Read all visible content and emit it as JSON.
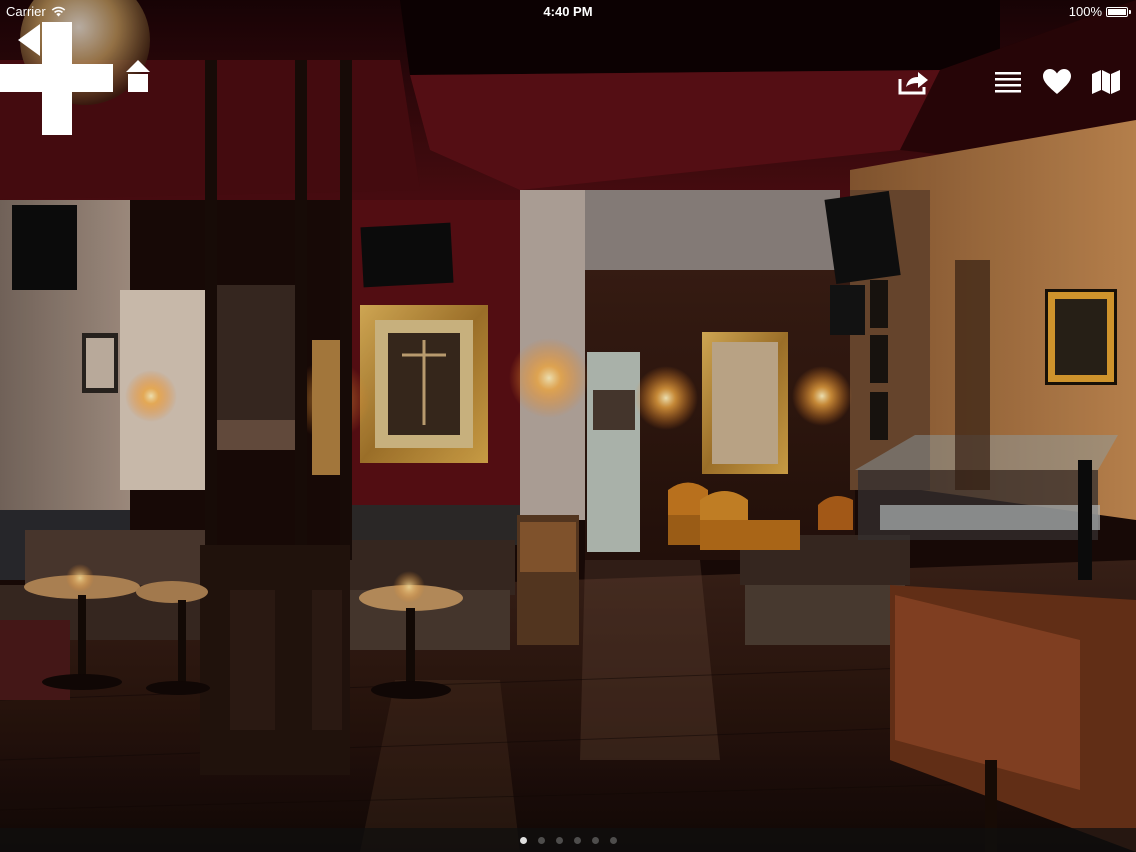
{
  "status_bar": {
    "carrier": "Carrier",
    "time": "4:40 PM",
    "battery": "100%",
    "battery_level": 1.0
  },
  "nav": {
    "back_icon": "back-arrow-icon",
    "add_icon": "plus-icon",
    "home_icon": "home-icon"
  },
  "toolbar": {
    "share_icon": "share-icon",
    "list_icon": "list-icon",
    "favorite_icon": "heart-icon",
    "map_icon": "map-icon"
  },
  "gallery": {
    "page_count": 6,
    "current_page": 1
  },
  "colors": {
    "ceiling": "#3a0b0e",
    "wall_red": "#5a0f14",
    "floor": "#2a1710",
    "lamp_glow": "#ffb347",
    "overlay_icon": "#ffffff"
  }
}
